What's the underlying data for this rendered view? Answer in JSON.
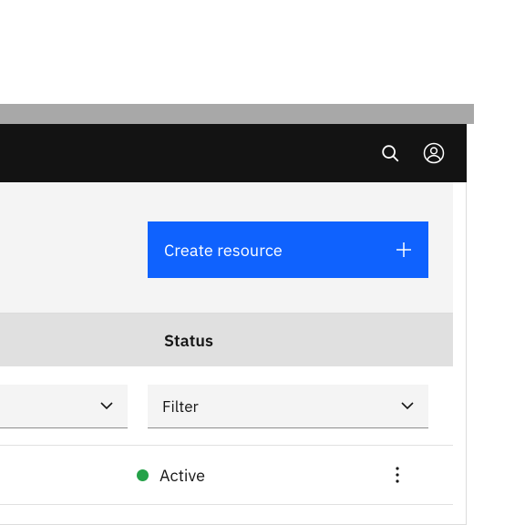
{
  "topbar": {
    "search_icon": "search",
    "user_icon": "user"
  },
  "actions": {
    "create_label": "Create resource",
    "create_icon": "plus"
  },
  "table": {
    "columns": {
      "status": "Status"
    },
    "filters": {
      "left_label": "",
      "status_label": "Filter"
    },
    "rows": [
      {
        "status_text": "Active",
        "status_color": "#24a148"
      }
    ]
  }
}
